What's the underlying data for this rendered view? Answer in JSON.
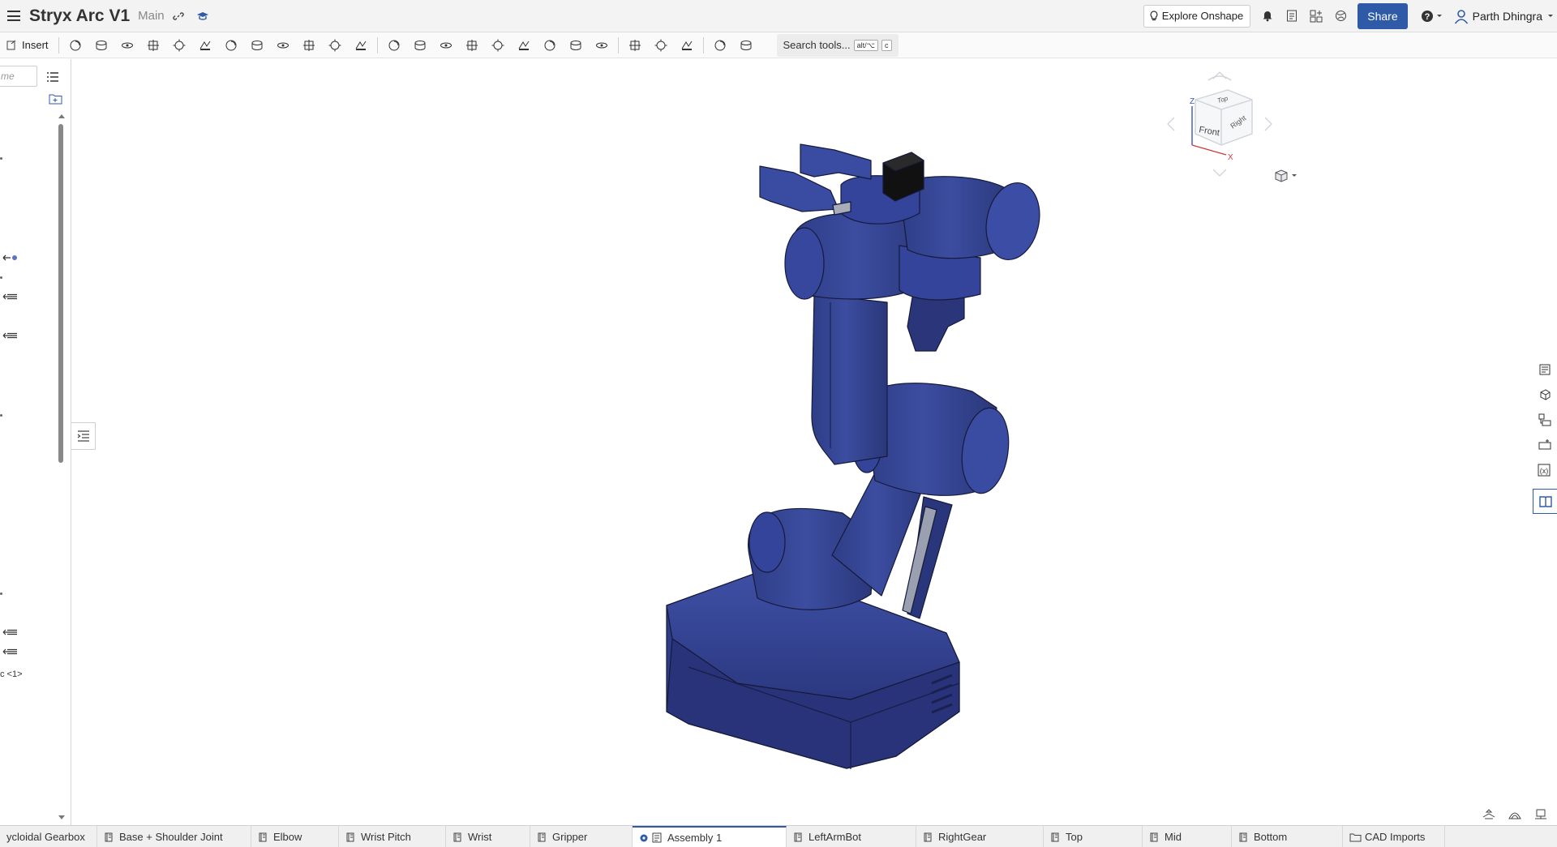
{
  "header": {
    "title": "Stryx Arc V1",
    "branch": "Main",
    "explore_label": "Explore Onshape",
    "share_label": "Share",
    "user_name": "Parth Dhingra"
  },
  "toolbar": {
    "insert_label": "Insert",
    "search_label": "Search tools...",
    "search_shortcut_mod": "alt/⌥",
    "search_shortcut_key": "c",
    "tool_icons": [
      "mate-connector-icon",
      "fastened-mate-icon",
      "revolute-mate-icon",
      "slider-mate-icon",
      "planar-mate-icon",
      "cylindrical-mate-icon",
      "pin-slot-mate-icon",
      "ball-mate-icon",
      "parallel-mate-icon",
      "tangent-mate-icon",
      "width-mate-icon",
      "group-icon",
      "relation-icon",
      "gear-relation-icon",
      "rack-pinion-icon",
      "screw-relation-icon",
      "linear-pattern-icon",
      "circular-pattern-icon",
      "mirror-icon",
      "replicate-icon",
      "gear-icon",
      "sprocket-icon",
      "array-icon",
      "explode-icon",
      "named-position-icon",
      "bom-icon"
    ]
  },
  "left_panel": {
    "filter_placeholder": "me",
    "instance_label": "c <1>"
  },
  "right_panel": {
    "icons": [
      "properties-icon",
      "appearance-icon",
      "parts-list-icon",
      "configuration-icon",
      "variables-icon",
      "bill-of-materials-icon"
    ]
  },
  "viewcube": {
    "faces": {
      "top": "Top",
      "front": "Front",
      "right": "Right"
    },
    "axes": {
      "z": "Z",
      "x": "X"
    }
  },
  "tabs": [
    {
      "label": "ycloidal Gearbox",
      "icon": "part-studio-icon",
      "active": false
    },
    {
      "label": "Base + Shoulder Joint",
      "icon": "part-studio-icon",
      "active": false
    },
    {
      "label": "Elbow",
      "icon": "part-studio-icon",
      "active": false
    },
    {
      "label": "Wrist Pitch",
      "icon": "part-studio-icon",
      "active": false
    },
    {
      "label": "Wrist",
      "icon": "part-studio-icon",
      "active": false
    },
    {
      "label": "Gripper",
      "icon": "part-studio-icon",
      "active": false
    },
    {
      "label": "Assembly 1",
      "icon": "assembly-icon",
      "active": true
    },
    {
      "label": "LeftArmBot",
      "icon": "part-studio-icon",
      "active": false
    },
    {
      "label": "RightGear",
      "icon": "part-studio-icon",
      "active": false
    },
    {
      "label": "Top",
      "icon": "part-studio-icon",
      "active": false
    },
    {
      "label": "Mid",
      "icon": "part-studio-icon",
      "active": false
    },
    {
      "label": "Bottom",
      "icon": "part-studio-icon",
      "active": false
    },
    {
      "label": "CAD Imports",
      "icon": "folder-icon",
      "active": false
    }
  ],
  "colors": {
    "model": "#3a4a9a",
    "accent": "#2e5aa7"
  }
}
